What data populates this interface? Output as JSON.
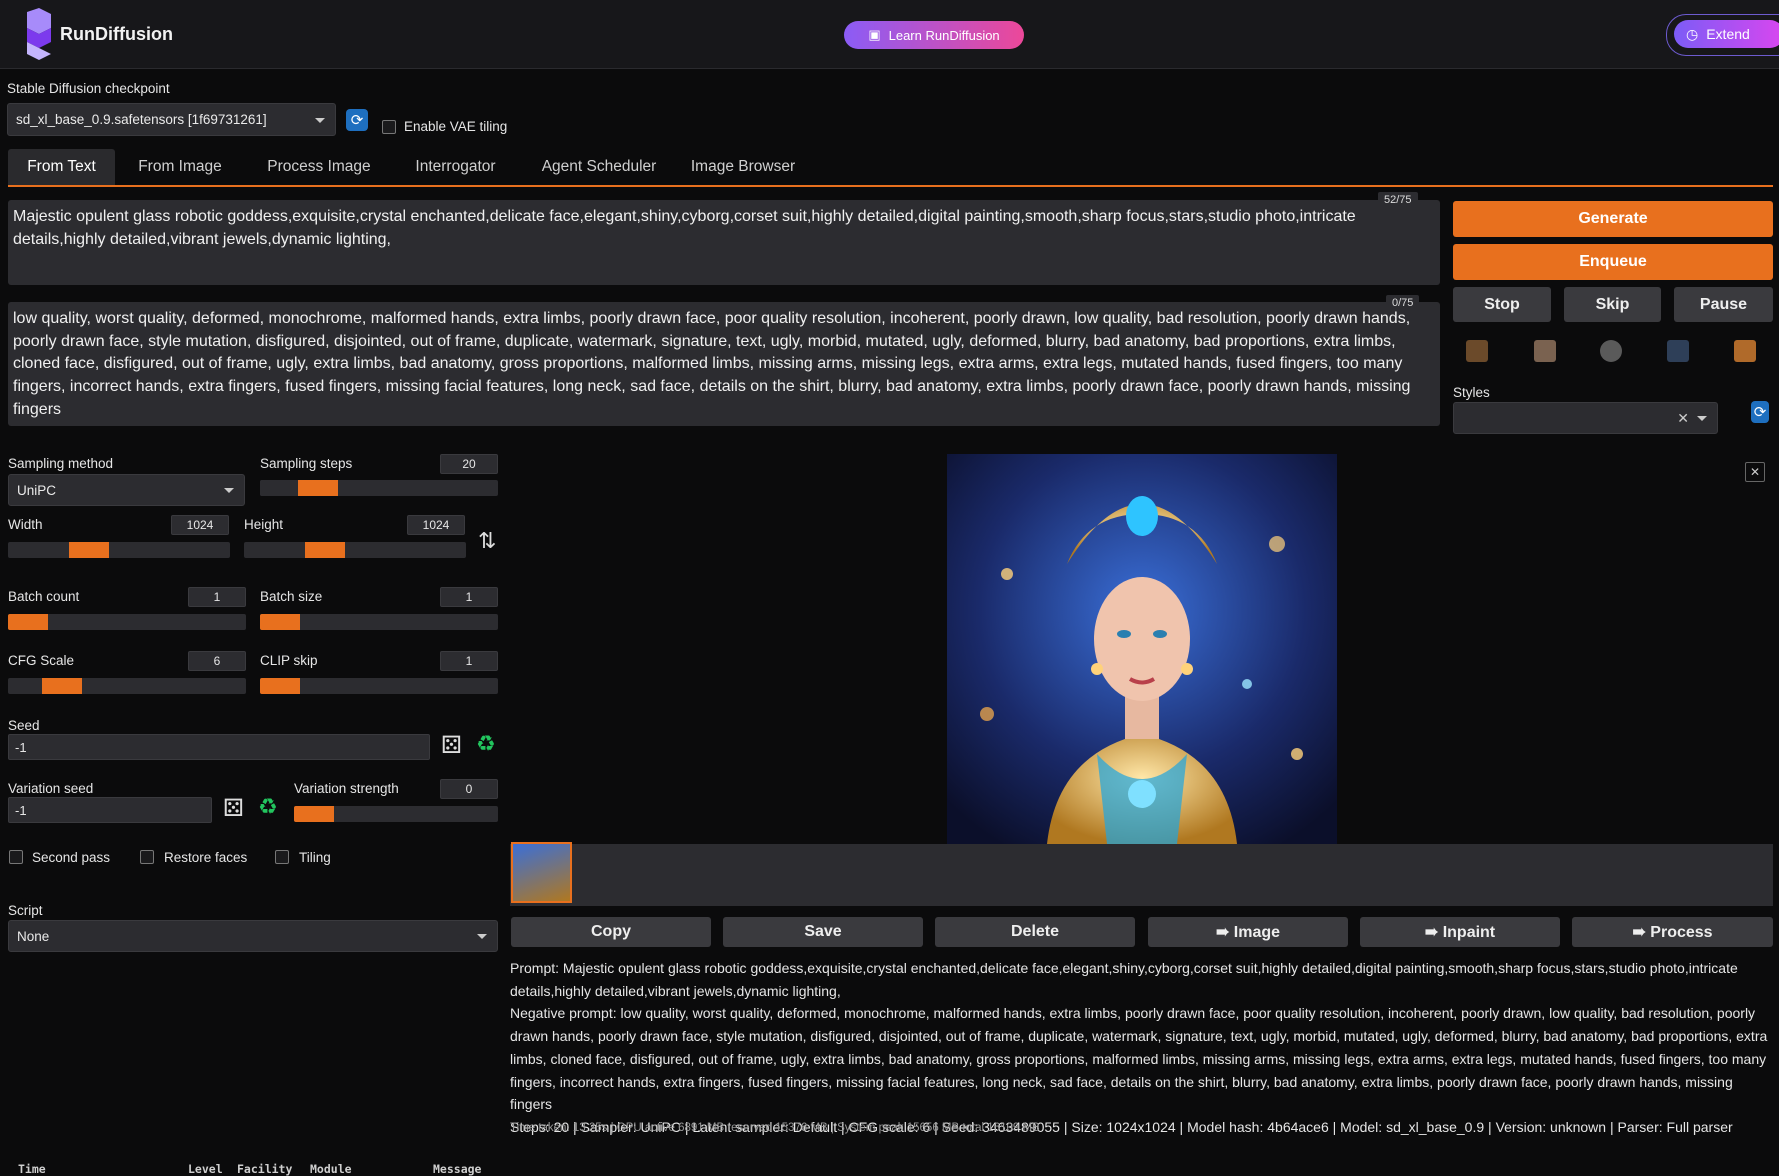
{
  "topbar": {
    "brand": "RunDiffusion",
    "learn_button": "Learn RunDiffusion",
    "extend_button": "Extend"
  },
  "checkpoint": {
    "label": "Stable Diffusion checkpoint",
    "value": "sd_xl_base_0.9.safetensors [1f69731261]",
    "vae_tiling_label": "Enable VAE tiling"
  },
  "tabs": [
    "From Text",
    "From Image",
    "Process Image",
    "Interrogator",
    "Agent Scheduler",
    "Image Browser"
  ],
  "prompt": {
    "text": "Majestic opulent glass robotic goddess,exquisite,crystal enchanted,delicate face,elegant,shiny,cyborg,corset suit,highly detailed,digital painting,smooth,sharp focus,stars,studio photo,intricate details,highly detailed,vibrant jewels,dynamic lighting,",
    "counter": "52/75"
  },
  "negative_prompt": {
    "text": "low quality, worst quality, deformed, monochrome, malformed hands, extra limbs, poorly drawn face, poor quality resolution, incoherent, poorly drawn, low quality, bad resolution, poorly drawn hands, poorly drawn face, style mutation, disfigured, disjointed, out of frame, duplicate, watermark, signature, text, ugly, morbid, mutated, ugly, deformed, blurry, bad anatomy, bad proportions, extra limbs, cloned face, disfigured, out of frame, ugly, extra limbs, bad anatomy, gross proportions, malformed limbs, missing arms, missing legs, extra arms, extra legs, mutated hands, fused fingers, too many fingers, incorrect hands, extra fingers, fused fingers, missing facial features, long neck, sad face, details on the shirt, blurry, bad anatomy, extra limbs, poorly drawn face, poorly drawn hands, missing fingers",
    "counter": "0/75"
  },
  "actions": {
    "generate": "Generate",
    "enqueue": "Enqueue",
    "stop": "Stop",
    "skip": "Skip",
    "pause": "Pause",
    "styles_label": "Styles"
  },
  "settings": {
    "sampling_method_label": "Sampling method",
    "sampling_method": "UniPC",
    "sampling_steps_label": "Sampling steps",
    "sampling_steps": "20",
    "width_label": "Width",
    "width": "1024",
    "height_label": "Height",
    "height": "1024",
    "batch_count_label": "Batch count",
    "batch_count": "1",
    "batch_size_label": "Batch size",
    "batch_size": "1",
    "cfg_label": "CFG Scale",
    "cfg": "6",
    "clip_label": "CLIP skip",
    "clip": "1",
    "seed_label": "Seed",
    "seed": "-1",
    "variation_seed_label": "Variation seed",
    "variation_seed": "-1",
    "variation_strength_label": "Variation strength",
    "variation_strength": "0",
    "second_pass": "Second pass",
    "restore_faces": "Restore faces",
    "tiling": "Tiling",
    "script_label": "Script",
    "script": "None"
  },
  "output_buttons": [
    "Copy",
    "Save",
    "Delete",
    "➠ Image",
    "➠ Inpaint",
    "➠ Process"
  ],
  "info": {
    "prompt_line": "Prompt: Majestic opulent glass robotic goddess,exquisite,crystal enchanted,delicate face,elegant,shiny,cyborg,corset suit,highly detailed,digital painting,smooth,sharp focus,stars,studio photo,intricate details,highly detailed,vibrant jewels,dynamic lighting,",
    "negative_line": "Negative prompt: low quality, worst quality, deformed, monochrome, malformed hands, extra limbs, poorly drawn face, poor quality resolution, incoherent, poorly drawn, low quality, bad resolution, poorly drawn hands, poorly drawn face, style mutation, disfigured, disjointed, out of frame, duplicate, watermark, signature, text, ugly, morbid, mutated, ugly, deformed, blurry, bad anatomy, bad proportions, extra limbs, cloned face, disfigured, out of frame, ugly, extra limbs, bad anatomy, gross proportions, malformed limbs, missing arms, missing legs, extra arms, extra legs, mutated hands, fused fingers, too many fingers, incorrect hands, extra fingers, fused fingers, missing facial features, long neck, sad face, details on the shirt, blurry, bad anatomy, extra limbs, poorly drawn face, poorly drawn hands, missing fingers",
    "params_line": "Steps: 20 | Sampler: UniPC | Latent sampler: Default | CFG scale: 6 | Seed: 3463489055 | Size: 1024x1024 | Model hash: 4b64ace6 | Model: sd_xl_base_0.9 | Version: unknown | Parser: Full parser",
    "time_line": "Time taken: 13.25s | GPU active 6891 MB reserved 15376 MB | System peak 15656 MB total 16109 MB"
  },
  "log_headers": [
    "Time",
    "Level",
    "Facility",
    "Module",
    "Message"
  ],
  "colors": {
    "accent": "#e8701e",
    "panel": "#2c2c30",
    "background": "#0b0b0c"
  }
}
